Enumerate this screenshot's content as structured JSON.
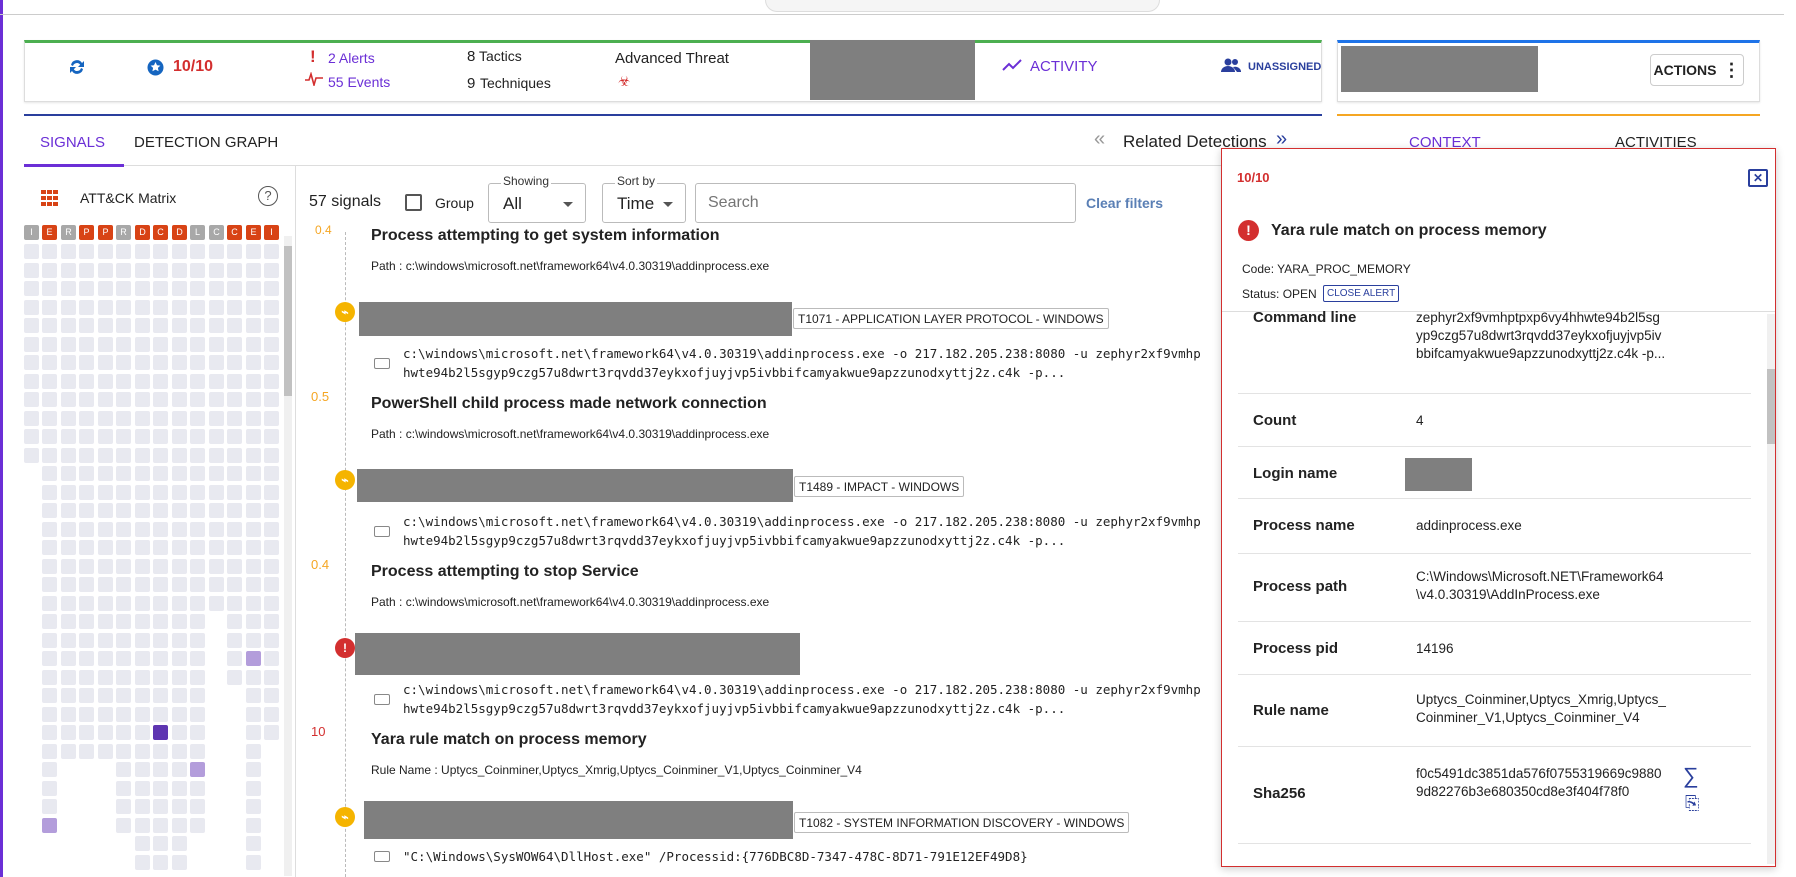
{
  "header": {
    "score": "10/10",
    "alerts": "2 Alerts",
    "events": "55 Events",
    "tactics_num": "8",
    "tactics_lbl": "Tactics",
    "techniques_num": "9",
    "techniques_lbl": "Techniques",
    "threat": "Advanced Threat",
    "activity": "ACTIVITY",
    "assignee": "UNASSIGNED",
    "actions": "ACTIONS"
  },
  "tabs": {
    "signals": "SIGNALS",
    "graph": "DETECTION GRAPH",
    "related": "Related Detections",
    "context": "CONTEXT",
    "activities": "ACTIVITIES"
  },
  "matrix": {
    "title": "ATT&CK Matrix",
    "headers": [
      "I",
      "E",
      "R",
      "P",
      "P",
      "R",
      "D",
      "C",
      "D",
      "L",
      "C",
      "C",
      "E",
      "I"
    ]
  },
  "filters": {
    "count": "57 signals",
    "group": "Group",
    "showing_lbl": "Showing",
    "showing_val": "All",
    "sort_lbl": "Sort by",
    "sort_val": "Time",
    "search_placeholder": "Search",
    "clear": "Clear filters"
  },
  "signals": [
    {
      "title": "Process attempting to get system information",
      "path": "Path : c:\\windows\\microsoft.net\\framework64\\v4.0.30319\\addinprocess.exe"
    },
    {
      "tech": "T1071 - APPLICATION LAYER PROTOCOL - WINDOWS",
      "cmd1": "c:\\windows\\microsoft.net\\framework64\\v4.0.30319\\addinprocess.exe -o 217.182.205.238:8080 -u zephyr2xf9vmhp",
      "cmd2": "hwte94b2l5sgyp9czg57u8dwrt3rqvdd37eykxofjuyjvp5ivbbifcamyakwue9apzzunodxyttj2z.c4k -p...",
      "score": "0.5",
      "title": "PowerShell child process made network connection",
      "path": "Path : c:\\windows\\microsoft.net\\framework64\\v4.0.30319\\addinprocess.exe"
    },
    {
      "tech": "T1489 - IMPACT - WINDOWS",
      "cmd1": "c:\\windows\\microsoft.net\\framework64\\v4.0.30319\\addinprocess.exe -o 217.182.205.238:8080 -u zephyr2xf9vmhp",
      "cmd2": "hwte94b2l5sgyp9czg57u8dwrt3rqvdd37eykxofjuyjvp5ivbbifcamyakwue9apzzunodxyttj2z.c4k -p...",
      "score": "0.4",
      "title": "Process attempting to stop Service",
      "path": "Path : c:\\windows\\microsoft.net\\framework64\\v4.0.30319\\addinprocess.exe"
    },
    {
      "cmd1": "c:\\windows\\microsoft.net\\framework64\\v4.0.30319\\addinprocess.exe -o 217.182.205.238:8080 -u zephyr2xf9vmhp",
      "cmd2": "hwte94b2l5sgyp9czg57u8dwrt3rqvdd37eykxofjuyjvp5ivbbifcamyakwue9apzzunodxyttj2z.c4k -p...",
      "score": "10",
      "title": "Yara rule match on process memory",
      "path": "Rule Name : Uptycs_Coinminer,Uptycs_Xmrig,Uptycs_Coinminer_V1,Uptycs_Coinminer_V4"
    },
    {
      "tech": "T1082 - SYSTEM INFORMATION DISCOVERY - WINDOWS",
      "cmd1": "\"C:\\Windows\\SysWOW64\\DllHost.exe\" /Processid:{776DBC8D-7347-478C-8D71-791E12EF49D8}"
    }
  ],
  "alert": {
    "score": "10/10",
    "title": "Yara rule match on process memory",
    "code": "Code: YARA_PROC_MEMORY",
    "status": "Status: OPEN",
    "close": "CLOSE ALERT",
    "rows": [
      {
        "k": "Command line",
        "v": "zephyr2xf9vmhptpxp6vy4hhwte94b2l5sgyp9czg57u8dwrt3rqvdd37eykxofjuyjvp5ivbbifcamyakwue9apzzunodxyttj2z.c4k -p..."
      },
      {
        "k": "Count",
        "v": "4"
      },
      {
        "k": "Login name",
        "v": ""
      },
      {
        "k": "Process name",
        "v": "addinprocess.exe"
      },
      {
        "k": "Process path",
        "v": "C:\\Windows\\Microsoft.NET\\Framework64\\v4.0.30319\\AddInProcess.exe"
      },
      {
        "k": "Process pid",
        "v": "14196"
      },
      {
        "k": "Rule name",
        "v": "Uptycs_Coinminer,Uptycs_Xmrig,Uptycs_Coinminer_V1,Uptycs_Coinminer_V4"
      },
      {
        "k": "Sha256",
        "v": "f0c5491dc3851da576f0755319669c98809d82276b3e680350cd8e3f404f78f0"
      }
    ]
  },
  "colors": {
    "accent": "#6b2fd6",
    "danger": "#d32f2f",
    "warn": "#f5a623",
    "link": "#1565c0"
  }
}
